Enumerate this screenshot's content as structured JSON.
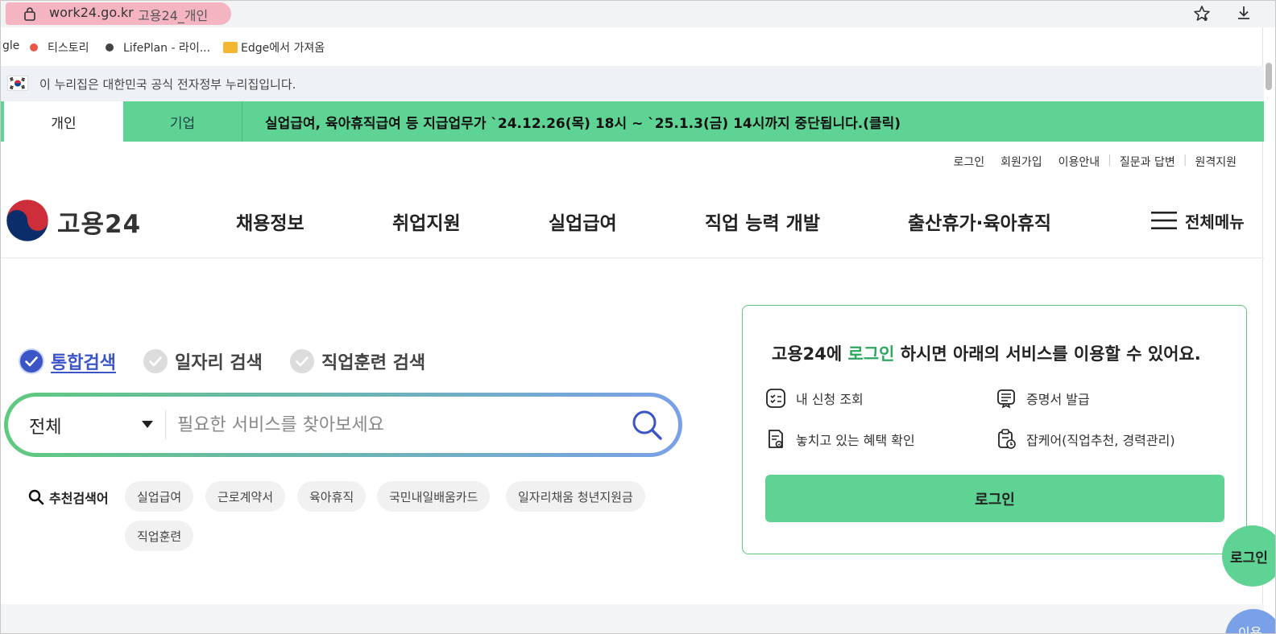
{
  "browser": {
    "domain": "work24.go.kr",
    "tab_title": "고용24_개인",
    "bookmarks": [
      {
        "label": "gle",
        "color": ""
      },
      {
        "label": "티스토리",
        "color": "#e8574a"
      },
      {
        "label": "LifePlan - 라이...",
        "color": "#444444"
      },
      {
        "label": "Edge에서 가져옴",
        "color": "#f5b731"
      }
    ]
  },
  "gov_banner": {
    "text": "이 누리집은 대한민국 공식 전자정부 누리집입니다."
  },
  "topnav": {
    "tab_personal": "개인",
    "tab_business": "기업",
    "notice": "실업급여, 육아휴직급여 등 지급업무가 `24.12.26(목) 18시 ~ `25.1.3(금) 14시까지 중단됩니다.(클릭)"
  },
  "util_links": [
    "로그인",
    "회원가입",
    "이용안내",
    "질문과 답변",
    "원격지원"
  ],
  "header": {
    "logo_text": "고용24",
    "menu": [
      "채용정보",
      "취업지원",
      "실업급여",
      "직업 능력 개발",
      "출산휴가·육아휴직"
    ],
    "all_menu": "전체메뉴"
  },
  "search": {
    "tabs": [
      "통합검색",
      "일자리 검색",
      "직업훈련 검색"
    ],
    "active_tab": 0,
    "select_value": "전체",
    "placeholder": "필요한 서비스를 찾아보세요",
    "recommend_label": "추천검색어",
    "keywords": [
      "실업급여",
      "근로계약서",
      "육아휴직",
      "국민내일배움카드",
      "일자리채움 청년지원금",
      "직업훈련"
    ]
  },
  "login_box": {
    "title_pre": "고용24에 ",
    "title_highlight": "로그인",
    "title_post": " 하시면 아래의 서비스를 이용할 수 있어요.",
    "services": [
      "내 신청 조회",
      "증명서 발급",
      "놓치고 있는 혜택 확인",
      "잡케어(직업추천, 경력관리)"
    ],
    "login_button": "로그인"
  },
  "floating": {
    "login": "로그인",
    "second": "이용"
  },
  "colors": {
    "accent_green": "#5fd393",
    "accent_blue": "#3b55c7"
  }
}
